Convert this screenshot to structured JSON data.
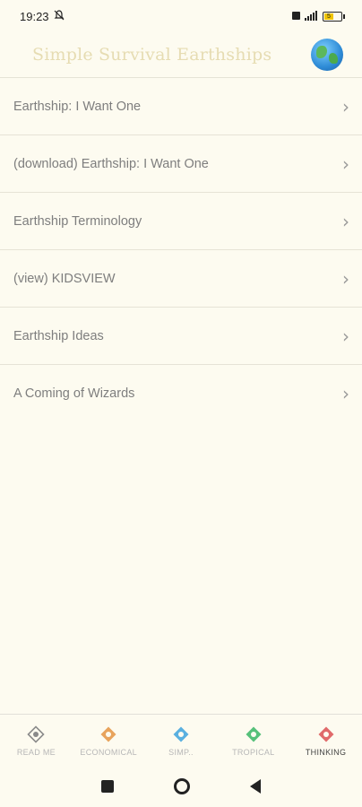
{
  "status": {
    "time": "19:23",
    "battery": "5"
  },
  "header": {
    "title": "Simple Survival Earthships"
  },
  "menu": [
    {
      "label": "Earthship: I Want One"
    },
    {
      "label": "(download) Earthship: I Want One"
    },
    {
      "label": "Earthship Terminology"
    },
    {
      "label": "(view) KIDSVIEW"
    },
    {
      "label": "Earthship Ideas"
    },
    {
      "label": "A Coming of Wizards"
    }
  ],
  "chevron": "›",
  "tabs": [
    {
      "label": "READ ME",
      "color": "#8a8a8a"
    },
    {
      "label": "ECONOMICAL",
      "color": "#e8a35c"
    },
    {
      "label": "SIMP..",
      "color": "#5ab0e0"
    },
    {
      "label": "TROPICAL",
      "color": "#56c07a"
    },
    {
      "label": "THINKING",
      "color": "#e06a6a"
    }
  ],
  "colors": {
    "background": "#fdfbf0",
    "title": "#e6dcb2"
  }
}
